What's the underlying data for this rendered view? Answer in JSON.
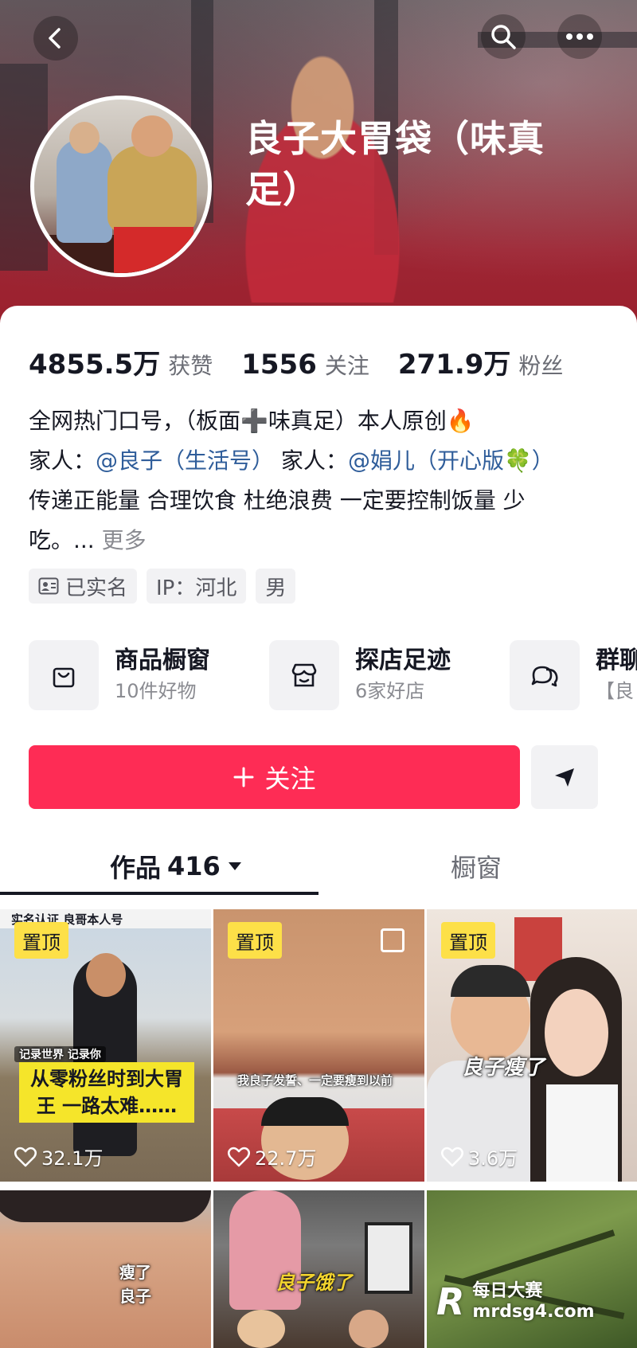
{
  "header": {
    "back_icon": "chevron-left-icon",
    "search_icon": "search-icon",
    "more_icon": "more-dots-icon",
    "nickname": "良子大胃袋（味真足）"
  },
  "stats": [
    {
      "value": "4855.5万",
      "label": "获赞"
    },
    {
      "value": "1556",
      "label": "关注"
    },
    {
      "value": "271.9万",
      "label": "粉丝"
    }
  ],
  "bio": {
    "line1": "全网热门口号，（板面➕味真足）本人原创🔥",
    "line2_prefix": "家人：",
    "mention1": "@良子（生活号）",
    "line2_middle": " 家人：",
    "mention2": "@娟儿（开心版🍀）",
    "line3": "传递正能量 合理饮食 杜绝浪费 一定要控制饭量 少",
    "line4": "吃。... ",
    "more": "更多"
  },
  "tags": [
    {
      "label": "已实名",
      "icon": "id-card-icon"
    },
    {
      "label": "IP：河北"
    },
    {
      "label": "男"
    }
  ],
  "shortcuts": [
    {
      "title": "商品橱窗",
      "subtitle": "10件好物",
      "icon": "shopping-bag-icon"
    },
    {
      "title": "探店足迹",
      "subtitle": "6家好店",
      "icon": "store-icon"
    },
    {
      "title": "群聊",
      "subtitle": "【良",
      "icon": "chat-bubbles-icon"
    }
  ],
  "actions": {
    "follow_label": "关注",
    "follow_icon": "plus-icon",
    "send_icon": "send-icon"
  },
  "tabs": {
    "works_label": "作品",
    "works_count": "416",
    "works_icon": "caret-down-icon",
    "shop_label": "橱窗"
  },
  "videos": [
    {
      "pin": "置顶",
      "likes": "32.1万",
      "top_text": "实名认证 良哥本人号",
      "small_text": "记录世界 记录你",
      "caption": "从零粉丝时到大胃王 一路太难……"
    },
    {
      "pin": "置顶",
      "likes": "22.7万",
      "caption": "我良子发誓、一定要瘦到以前"
    },
    {
      "pin": "置顶",
      "likes": "3.6万",
      "caption": "良子瘦了"
    },
    {
      "caption": "瘦了 良子"
    },
    {
      "caption": "良子饿了"
    },
    {}
  ],
  "watermark": {
    "logo": "R",
    "line1": "每日大赛",
    "line2": "mrdsg4.com"
  },
  "colors": {
    "accent": "#fe2c55",
    "pin_bg": "#fde048",
    "mention": "#2f5d9a"
  }
}
